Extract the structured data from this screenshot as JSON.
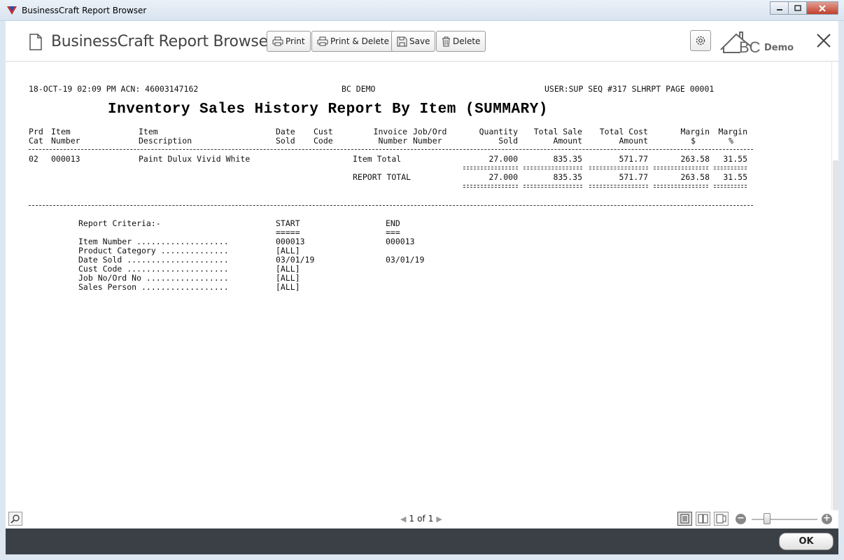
{
  "window": {
    "title": "BusinessCraft Report Browser"
  },
  "header": {
    "app_title": "BusinessCraft Report Browser",
    "buttons": {
      "print": "Print",
      "print_delete": "Print & Delete",
      "save": "Save",
      "delete": "Delete"
    },
    "logo_text": "BC",
    "logo_demo": "Demo"
  },
  "report": {
    "top_left": "18-OCT-19 02:09 PM ACN: 46003147162",
    "top_center": "BC DEMO",
    "top_right": "USER:SUP SEQ #317 SLHRPT PAGE 00001",
    "title": "Inventory Sales History Report By Item (SUMMARY)",
    "columns": {
      "prd_cat": [
        "Prd",
        "Cat"
      ],
      "item_number": [
        "Item",
        "Number"
      ],
      "item_description": [
        "Item",
        "Description"
      ],
      "date_sold": [
        "Date",
        "Sold"
      ],
      "cust_code": [
        "Cust",
        "Code"
      ],
      "invoice_number": [
        "Invoice",
        "Number"
      ],
      "job_ord": [
        "Job/Ord",
        "Number"
      ],
      "quantity_sold": [
        "Quantity",
        "Sold"
      ],
      "total_sale": [
        "Total Sale",
        "Amount"
      ],
      "total_cost": [
        "Total Cost",
        "Amount"
      ],
      "margin_dollar": [
        "Margin",
        "$"
      ],
      "margin_pct": [
        "Margin",
        "%"
      ]
    },
    "rows": [
      {
        "cat": "02",
        "item": "000013",
        "desc": "Paint Dulux Vivid White",
        "label": "Item Total",
        "qty": "27.000",
        "sale": "835.35",
        "cost": "571.77",
        "margin": "263.58",
        "pct": "31.55"
      }
    ],
    "total": {
      "label": "REPORT TOTAL",
      "qty": "27.000",
      "sale": "835.35",
      "cost": "571.77",
      "margin": "263.58",
      "pct": "31.55"
    },
    "criteria": {
      "heading": "Report Criteria:-",
      "start_label": "START",
      "start_underline": "=====",
      "end_label": "END",
      "end_underline": "===",
      "items": [
        {
          "label": "Item Number ...................",
          "start": "000013",
          "end": "000013"
        },
        {
          "label": "Product Category ..............",
          "start": "[ALL]",
          "end": ""
        },
        {
          "label": "Date Sold .....................",
          "start": "03/01/19",
          "end": "03/01/19"
        },
        {
          "label": "Cust Code .....................",
          "start": "[ALL]",
          "end": ""
        },
        {
          "label": "Job No/Ord No .................",
          "start": "[ALL]",
          "end": ""
        },
        {
          "label": "Sales Person ..................",
          "start": "[ALL]",
          "end": ""
        }
      ]
    }
  },
  "pager": {
    "current": "1",
    "of_label": "of",
    "total": "1"
  },
  "footer": {
    "ok_label": "OK"
  }
}
